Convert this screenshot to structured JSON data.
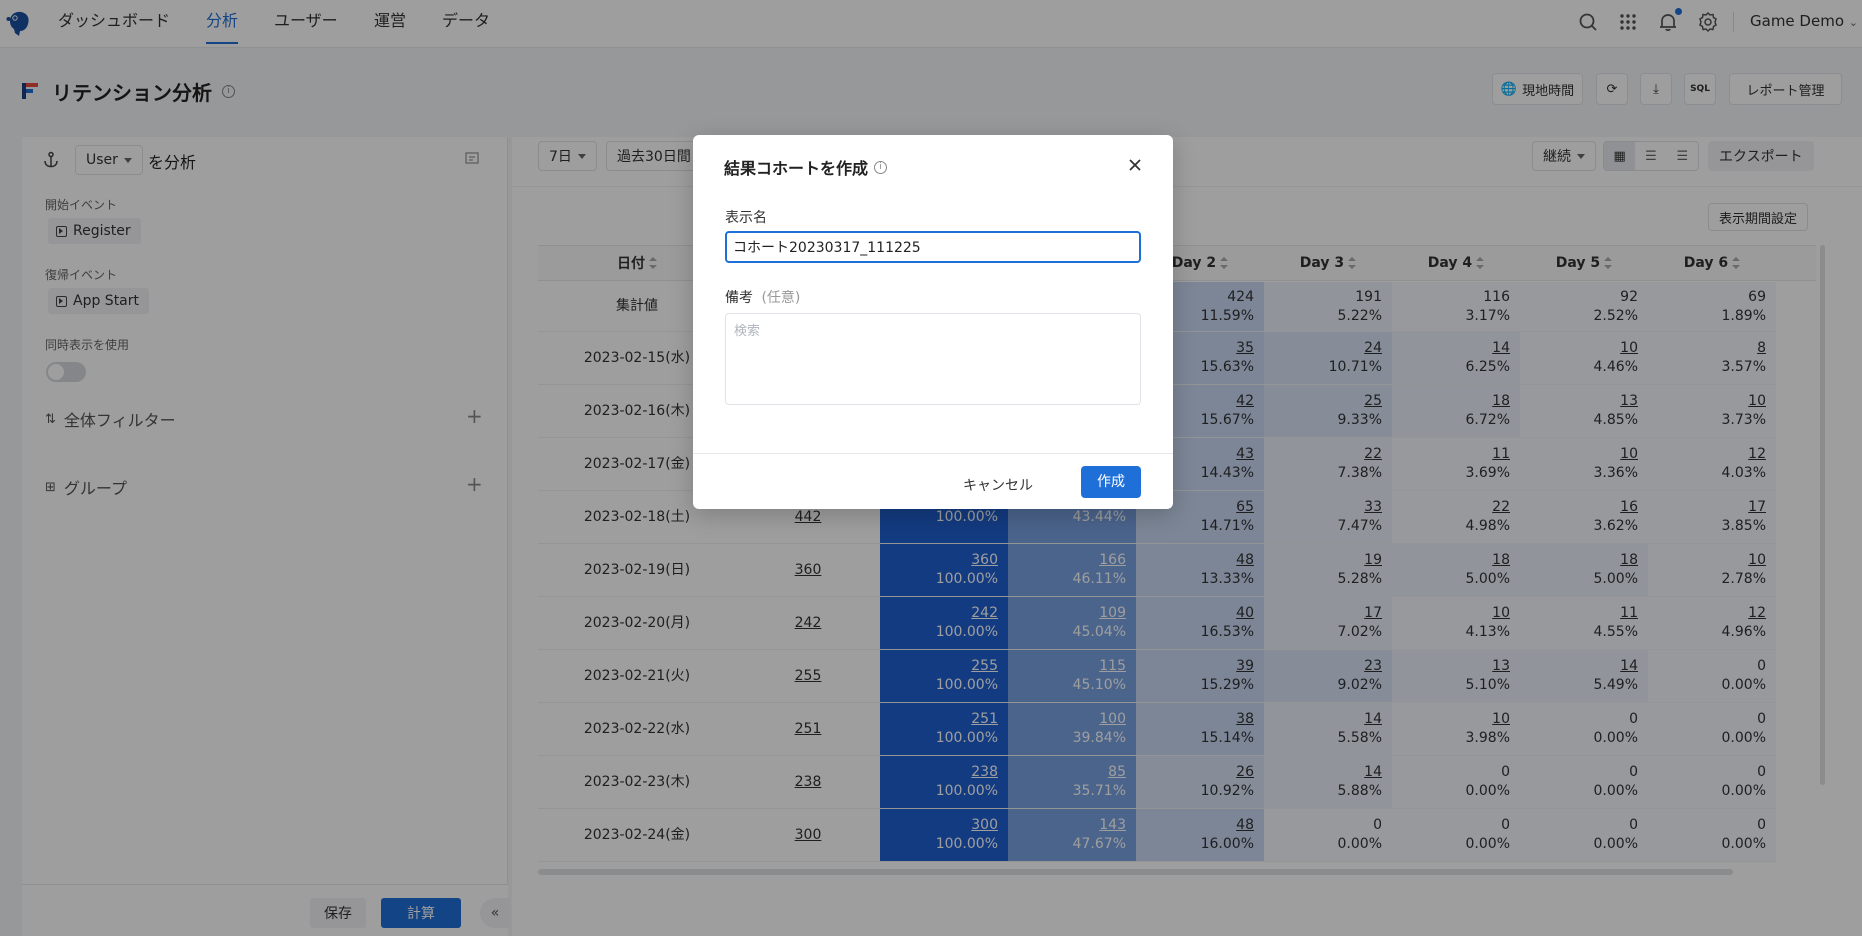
{
  "topbar": {
    "nav": [
      "ダッシュボード",
      "分析",
      "ユーザー",
      "運営",
      "データ"
    ],
    "active_nav": "分析",
    "project": "Game Demo",
    "accent": "#1f6fd9"
  },
  "page": {
    "title": "リテンション分析",
    "buttons": {
      "local_time": "現地時間",
      "sql": "SQL",
      "report_manage": "レポート管理"
    }
  },
  "left": {
    "entity": "User",
    "analyze_suffix": "を分析",
    "start_event_label": "開始イベント",
    "start_event": "Register",
    "return_event_label": "復帰イベント",
    "return_event": "App Start",
    "simultaneous_label": "同時表示を使用",
    "global_filter": "全体フィルター",
    "group": "グループ",
    "save": "保存",
    "calc": "計算"
  },
  "toolbar": {
    "period": "7日",
    "range": "過去30日間",
    "mode": "継続",
    "export": "エクスポート",
    "display_period": "表示期間設定"
  },
  "table": {
    "headers": [
      "日付",
      "Day 2",
      "Day 3",
      "Day 4",
      "Day 5",
      "Day 6"
    ],
    "summary": {
      "label": "集計値",
      "day2": [
        "424",
        "11.59%"
      ],
      "day3": [
        "191",
        "5.22%"
      ],
      "day4": [
        "116",
        "3.17%"
      ],
      "day5": [
        "92",
        "2.52%"
      ],
      "day6": [
        "69",
        "1.89%"
      ]
    },
    "rows": [
      {
        "date": "2023-02-15(水)",
        "users": "",
        "d0": [
          "",
          ""
        ],
        "d1": [
          "",
          ""
        ],
        "d2": [
          "35",
          "15.63%"
        ],
        "d3": [
          "24",
          "10.71%"
        ],
        "d4": [
          "14",
          "6.25%"
        ],
        "d5": [
          "10",
          "4.46%"
        ],
        "d6": [
          "8",
          "3.57%"
        ]
      },
      {
        "date": "2023-02-16(木)",
        "users": "",
        "d0": [
          "",
          ""
        ],
        "d1": [
          "",
          ""
        ],
        "d2": [
          "42",
          "15.67%"
        ],
        "d3": [
          "25",
          "9.33%"
        ],
        "d4": [
          "18",
          "6.72%"
        ],
        "d5": [
          "13",
          "4.85%"
        ],
        "d6": [
          "10",
          "3.73%"
        ]
      },
      {
        "date": "2023-02-17(金)",
        "users": "",
        "d0": [
          "",
          ""
        ],
        "d1": [
          "",
          ""
        ],
        "d2": [
          "43",
          "14.43%"
        ],
        "d3": [
          "22",
          "7.38%"
        ],
        "d4": [
          "11",
          "3.69%"
        ],
        "d5": [
          "10",
          "3.36%"
        ],
        "d6": [
          "12",
          "4.03%"
        ]
      },
      {
        "date": "2023-02-18(土)",
        "users": "442",
        "d0": [
          "",
          "100.00%"
        ],
        "d1": [
          "",
          "43.44%"
        ],
        "d2": [
          "65",
          "14.71%"
        ],
        "d3": [
          "33",
          "7.47%"
        ],
        "d4": [
          "22",
          "4.98%"
        ],
        "d5": [
          "16",
          "3.62%"
        ],
        "d6": [
          "17",
          "3.85%"
        ]
      },
      {
        "date": "2023-02-19(日)",
        "users": "360",
        "d0": [
          "360",
          "100.00%"
        ],
        "d1": [
          "166",
          "46.11%"
        ],
        "d2": [
          "48",
          "13.33%"
        ],
        "d3": [
          "19",
          "5.28%"
        ],
        "d4": [
          "18",
          "5.00%"
        ],
        "d5": [
          "18",
          "5.00%"
        ],
        "d6": [
          "10",
          "2.78%"
        ]
      },
      {
        "date": "2023-02-20(月)",
        "users": "242",
        "d0": [
          "242",
          "100.00%"
        ],
        "d1": [
          "109",
          "45.04%"
        ],
        "d2": [
          "40",
          "16.53%"
        ],
        "d3": [
          "17",
          "7.02%"
        ],
        "d4": [
          "10",
          "4.13%"
        ],
        "d5": [
          "11",
          "4.55%"
        ],
        "d6": [
          "12",
          "4.96%"
        ]
      },
      {
        "date": "2023-02-21(火)",
        "users": "255",
        "d0": [
          "255",
          "100.00%"
        ],
        "d1": [
          "115",
          "45.10%"
        ],
        "d2": [
          "39",
          "15.29%"
        ],
        "d3": [
          "23",
          "9.02%"
        ],
        "d4": [
          "13",
          "5.10%"
        ],
        "d5": [
          "14",
          "5.49%"
        ],
        "d6": [
          "0",
          "0.00%"
        ]
      },
      {
        "date": "2023-02-22(水)",
        "users": "251",
        "d0": [
          "251",
          "100.00%"
        ],
        "d1": [
          "100",
          "39.84%"
        ],
        "d2": [
          "38",
          "15.14%"
        ],
        "d3": [
          "14",
          "5.58%"
        ],
        "d4": [
          "10",
          "3.98%"
        ],
        "d5": [
          "0",
          "0.00%"
        ],
        "d6": [
          "0",
          "0.00%"
        ]
      },
      {
        "date": "2023-02-23(木)",
        "users": "238",
        "d0": [
          "238",
          "100.00%"
        ],
        "d1": [
          "85",
          "35.71%"
        ],
        "d2": [
          "26",
          "10.92%"
        ],
        "d3": [
          "14",
          "5.88%"
        ],
        "d4": [
          "0",
          "0.00%"
        ],
        "d5": [
          "0",
          "0.00%"
        ],
        "d6": [
          "0",
          "0.00%"
        ]
      },
      {
        "date": "2023-02-24(金)",
        "users": "300",
        "d0": [
          "300",
          "100.00%"
        ],
        "d1": [
          "143",
          "47.67%"
        ],
        "d2": [
          "48",
          "16.00%"
        ],
        "d3": [
          "0",
          "0.00%"
        ],
        "d4": [
          "0",
          "0.00%"
        ],
        "d5": [
          "0",
          "0.00%"
        ],
        "d6": [
          "0",
          "0.00%"
        ]
      }
    ]
  },
  "modal": {
    "title": "結果コホートを作成",
    "name_label": "表示名",
    "name_value": "コホート20230317_111225",
    "note_label": "備考",
    "note_optional": "(任意)",
    "note_placeholder": "検索",
    "cancel": "キャンセル",
    "create": "作成"
  }
}
